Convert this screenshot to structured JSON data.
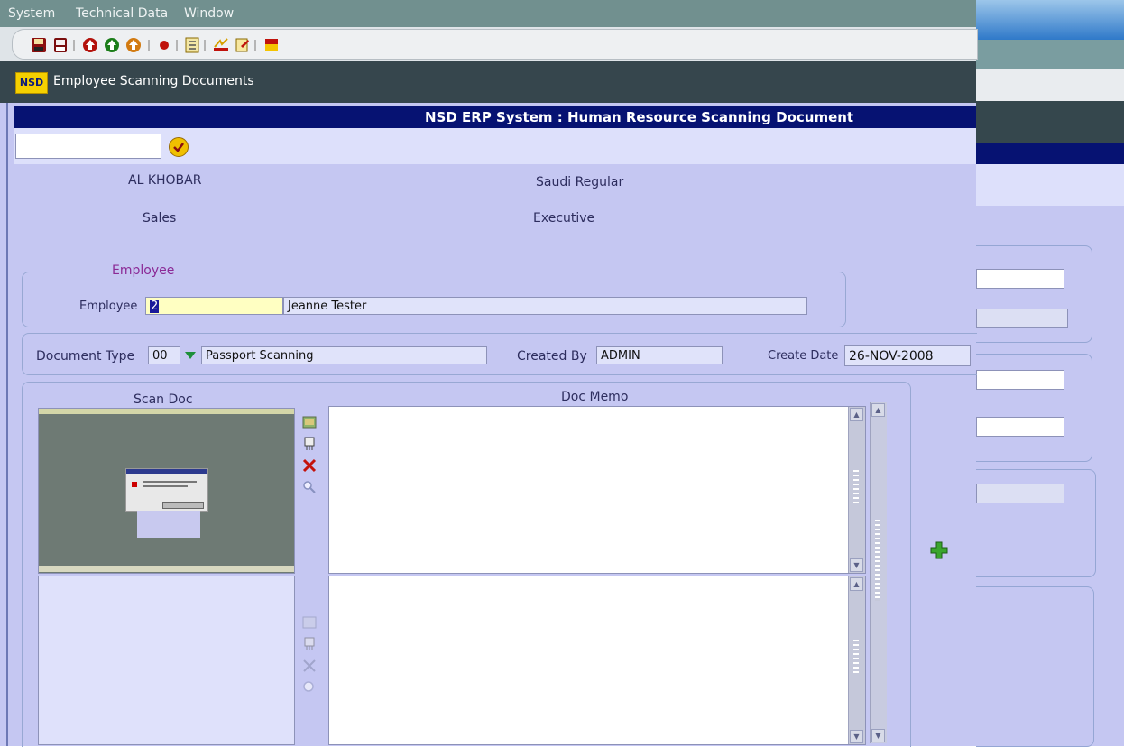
{
  "menu": {
    "system": "System",
    "technical_data": "Technical Data",
    "window": "Window"
  },
  "toolbar": {
    "icons": [
      "save-icon",
      "document-icon",
      "nav-up-red-icon",
      "nav-up-green-icon",
      "nav-up-orange-icon",
      "record-icon",
      "list-icon",
      "chart-icon",
      "edit-doc-icon",
      "exit-icon"
    ]
  },
  "window": {
    "logo": "NSD",
    "title": "Employee Scanning Documents"
  },
  "header": {
    "title": "NSD ERP System : Human Resource Scanning Document"
  },
  "info": {
    "location": "AL KHOBAR",
    "category": "Saudi Regular",
    "department": "Sales",
    "grade": "Executive"
  },
  "employee_section": {
    "legend": "Employee",
    "label": "Employee",
    "id_value": "2",
    "name_value": "Jeanne Tester"
  },
  "document": {
    "type_label": "Document Type",
    "type_code": "00",
    "type_name": "Passport Scanning",
    "created_by_label": "Created By",
    "created_by_value": "ADMIN",
    "create_date_label": "Create Date",
    "create_date_value": "26-NOV-2008"
  },
  "scan": {
    "scan_doc_label": "Scan Doc",
    "doc_memo_label": "Doc Memo"
  },
  "colors": {
    "form_bg": "#c5c7f2",
    "header_bg": "#061272",
    "titlebar_bg": "#36464d",
    "menubar_bg": "#71908f",
    "legend_text": "#8b2a96"
  }
}
